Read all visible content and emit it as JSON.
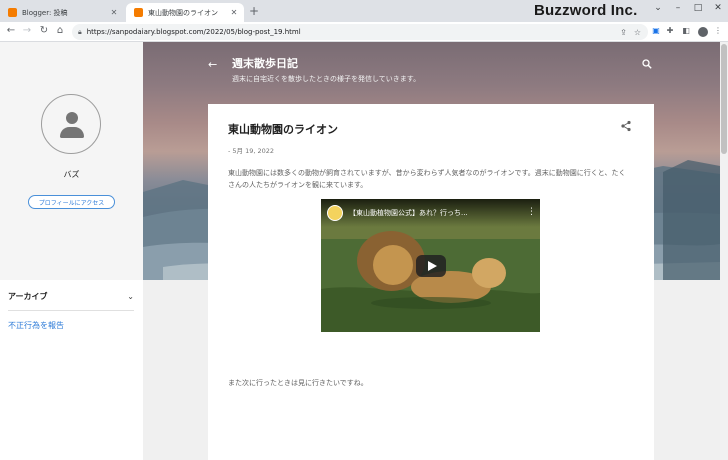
{
  "browser": {
    "tabs": [
      {
        "label": "Blogger: 投稿",
        "close": "✕"
      },
      {
        "label": "東山動物園のライオン",
        "close": "✕"
      }
    ],
    "new_tab": "+",
    "brand": "Buzzword Inc.",
    "url": "https://sanpodaiary.blogspot.com/2022/05/blog-post_19.html",
    "controls": {
      "minimize": "–",
      "maximize": "□",
      "close": "✕"
    },
    "nav": {
      "back": "←",
      "forward": "→",
      "reload": "↻",
      "home": "⌂"
    }
  },
  "sidebar": {
    "profile_name": "バズ",
    "profile_button": "プロフィールにアクセス",
    "archive_title": "アーカイブ",
    "report_link": "不正行為を報告"
  },
  "header": {
    "blog_title": "週末散歩日記",
    "blog_description": "週末に自宅近くを散歩したときの様子を発信していきます。"
  },
  "post": {
    "title": "東山動物園のライオン",
    "date": "- 5月 19, 2022",
    "body": "東山動物園には数多くの動物が飼育されていますが、昔から変わらず人気者なのがライオンです。週末に動物園に行くと、たくさんの人たちがライオンを観に来ています。",
    "video_title": "【東山動植物園公式】あれ？行っち...",
    "video_menu": "⋮",
    "footer": "また次に行ったときは見に行きたいですね。"
  },
  "colors": {
    "accent": "#2d7bd8",
    "hero_top": "#7a6c74",
    "hero_bottom": "#5d7080"
  }
}
